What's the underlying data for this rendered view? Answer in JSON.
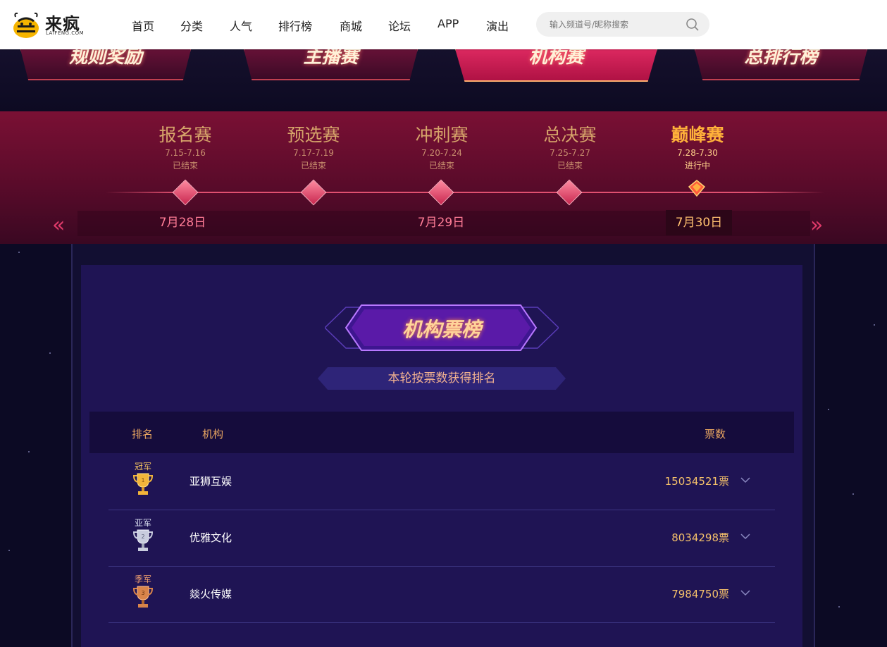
{
  "header": {
    "logo_text": "来疯",
    "logo_sub": "LAIFENG.COM",
    "nav": [
      "首页",
      "分类",
      "人气",
      "排行榜",
      "商城",
      "论坛",
      "APP",
      "演出"
    ],
    "search_placeholder": "输入频道号/昵称搜索"
  },
  "banner_tabs": [
    "规则奖励",
    "主播赛",
    "机构赛",
    "总排行榜"
  ],
  "active_tab": "机构赛",
  "stages": [
    {
      "name": "报名赛",
      "dates": "7.15-7.16",
      "status": "已结束"
    },
    {
      "name": "预选赛",
      "dates": "7.17-7.19",
      "status": "已结束"
    },
    {
      "name": "冲刺赛",
      "dates": "7.20-7.24",
      "status": "已结束"
    },
    {
      "name": "总决赛",
      "dates": "7.25-7.27",
      "status": "已结束"
    },
    {
      "name": "巅峰赛",
      "dates": "7.28-7.30",
      "status": "进行中"
    }
  ],
  "day_tabs": [
    "7月28日",
    "7月29日",
    "7月30日"
  ],
  "selected_day": "7月30日",
  "board": {
    "title": "机构票榜",
    "subtitle": "本轮按票数获得排名",
    "columns": {
      "rank": "排名",
      "org": "机构",
      "votes": "票数"
    },
    "rows": [
      {
        "medal": "冠军",
        "org": "亚狮互娱",
        "votes": "15034521票"
      },
      {
        "medal": "亚军",
        "org": "优雅文化",
        "votes": "8034298票"
      },
      {
        "medal": "季军",
        "org": "燚火传媒",
        "votes": "7984750票"
      }
    ]
  },
  "colors": {
    "accent_gold": "#f4c06a",
    "timeline_red": "#7a1034",
    "panel_purple": "#1f1454",
    "current_stage": "#ffb13a"
  }
}
